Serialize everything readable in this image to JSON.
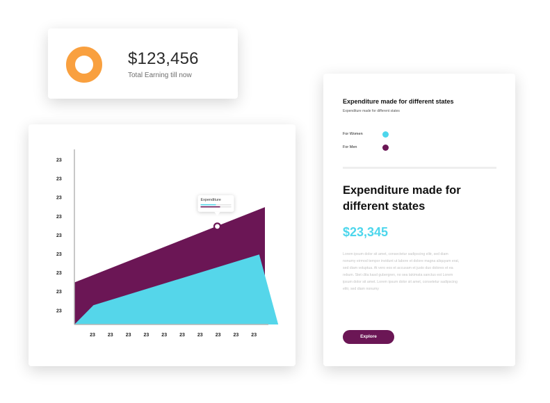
{
  "earnings": {
    "value": "$123,456",
    "label": "Total Earning till now",
    "donut_color": "#f9a03f"
  },
  "chart_data": {
    "type": "area",
    "title": "",
    "xlabel": "",
    "ylabel": "",
    "x_tick_labels": [
      "23",
      "23",
      "23",
      "23",
      "23",
      "23",
      "23",
      "23",
      "23",
      "23"
    ],
    "y_tick_labels": [
      "23",
      "23",
      "23",
      "23",
      "23",
      "23",
      "23",
      "23",
      "23"
    ],
    "x": [
      0,
      1,
      9,
      10
    ],
    "xlim": [
      0,
      10
    ],
    "ylim": [
      0,
      10
    ],
    "series": [
      {
        "x": [
          0,
          10
        ],
        "values": [
          2.4,
          6.7
        ],
        "color": "#6b1655"
      },
      {
        "x": [
          0,
          1,
          9.7,
          10.7
        ],
        "values": [
          0,
          1.1,
          4.0,
          0
        ],
        "color": "#55d6ea"
      }
    ],
    "tooltip": {
      "label": "Expenditure",
      "x": 7.5,
      "y": 5.6
    },
    "grid": false
  },
  "info": {
    "title": "Expenditure made for different states",
    "subtitle": "Expenditure made for different states",
    "legend": [
      {
        "label": "For Women",
        "color": "#4dd6ec"
      },
      {
        "label": "For Men",
        "color": "#6b1655"
      }
    ],
    "headline": "Expenditure made for different states",
    "amount": "$23,345",
    "body": "Lorem ipsum dolor sit amet, consectetur sadipscing elitr, sed diam nonumy eirmod tempor invidunt ut labore et dolore magna aliquyam erat, sed diam voluptua. At vero eos et accusam et justo duo dolores et ea rebum. Stet clita kasd gubergren, no sea takimata sanctus est Lorem ipsum dolor sit amet. Lorem ipsum dolor sit amet, consetetur sadipscing elitr, sed diam nonumy",
    "button_label": "Explore"
  }
}
